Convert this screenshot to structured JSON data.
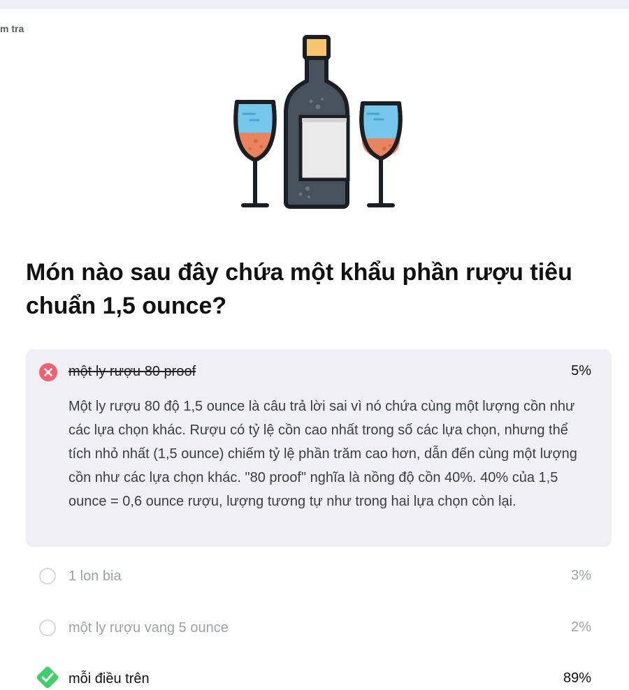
{
  "breadcrumb": "m tra",
  "question": "Món nào sau đây chứa một khẩu phần rượu tiêu chuẩn 1,5 ounce?",
  "options": [
    {
      "label": "một ly rượu 80 proof",
      "percent": "5%",
      "state": "selected-wrong",
      "explanation": "Một ly rượu 80 độ 1,5 ounce là câu trả lời sai vì nó chứa cùng một lượng cồn như các lựa chọn khác. Rượu có tỷ lệ cồn cao nhất trong số các lựa chọn, nhưng thể tích nhỏ nhất (1,5 ounce) chiếm tỷ lệ phần trăm cao hơn, dẫn đến cùng một lượng cồn như các lựa chọn khác. \"80 proof\" nghĩa là nồng độ cồn 40%. 40% của 1,5 ounce = 0,6 ounce rượu, lượng tương tự như trong hai lựa chọn còn lại."
    },
    {
      "label": "1 lon bia",
      "percent": "3%",
      "state": "unselected"
    },
    {
      "label": "một ly rượu vang 5 ounce",
      "percent": "2%",
      "state": "unselected"
    },
    {
      "label": "mỗi điều trên",
      "percent": "89%",
      "state": "correct"
    }
  ],
  "colors": {
    "wrong": "#f0606f",
    "correct": "#3fcf6b",
    "card_bg": "#f0f0f4",
    "muted_text": "#9da1a6"
  },
  "icons": {
    "illustration": "wine-bottle-and-glasses-illustration",
    "wrong": "x-circle-icon",
    "correct": "check-diamond-icon",
    "radio": "radio-empty-icon"
  }
}
